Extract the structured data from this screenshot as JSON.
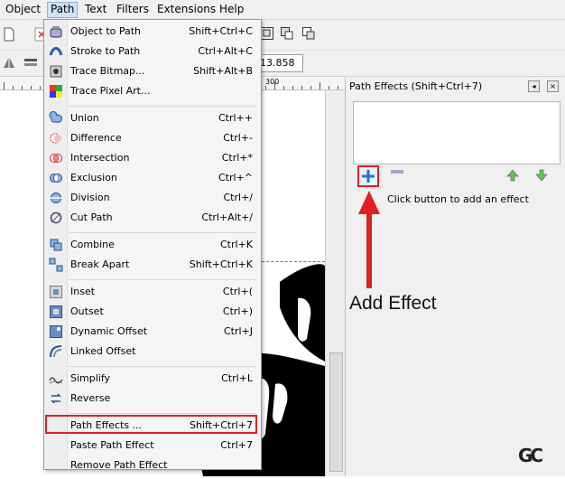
{
  "menubar": {
    "items": [
      "Object",
      "Path",
      "Text",
      "Filters",
      "Extensions",
      "Help"
    ],
    "active": "Path"
  },
  "toolbar": {
    "coord_value": "13.858"
  },
  "ruler": {
    "label": "300"
  },
  "path_menu": {
    "groups": [
      [
        {
          "label": "Object to Path",
          "shortcut": "Shift+Ctrl+C",
          "icon": "object-to-path-icon"
        },
        {
          "label": "Stroke to Path",
          "shortcut": "Ctrl+Alt+C",
          "icon": "stroke-to-path-icon"
        },
        {
          "label": "Trace Bitmap...",
          "shortcut": "Shift+Alt+B",
          "icon": "trace-bitmap-icon"
        },
        {
          "label": "Trace Pixel Art...",
          "shortcut": "",
          "icon": "trace-pixel-art-icon"
        }
      ],
      [
        {
          "label": "Union",
          "shortcut": "Ctrl++",
          "icon": "union-icon"
        },
        {
          "label": "Difference",
          "shortcut": "Ctrl+-",
          "icon": "difference-icon"
        },
        {
          "label": "Intersection",
          "shortcut": "Ctrl+*",
          "icon": "intersection-icon"
        },
        {
          "label": "Exclusion",
          "shortcut": "Ctrl+^",
          "icon": "exclusion-icon"
        },
        {
          "label": "Division",
          "shortcut": "Ctrl+/",
          "icon": "division-icon"
        },
        {
          "label": "Cut Path",
          "shortcut": "Ctrl+Alt+/",
          "icon": "cut-path-icon"
        }
      ],
      [
        {
          "label": "Combine",
          "shortcut": "Ctrl+K",
          "icon": "combine-icon"
        },
        {
          "label": "Break Apart",
          "shortcut": "Shift+Ctrl+K",
          "icon": "break-apart-icon"
        }
      ],
      [
        {
          "label": "Inset",
          "shortcut": "Ctrl+(",
          "icon": "inset-icon"
        },
        {
          "label": "Outset",
          "shortcut": "Ctrl+)",
          "icon": "outset-icon"
        },
        {
          "label": "Dynamic Offset",
          "shortcut": "Ctrl+J",
          "icon": "dynamic-offset-icon"
        },
        {
          "label": "Linked Offset",
          "shortcut": "",
          "icon": "linked-offset-icon"
        }
      ],
      [
        {
          "label": "Simplify",
          "shortcut": "Ctrl+L",
          "icon": "simplify-icon"
        },
        {
          "label": "Reverse",
          "shortcut": "",
          "icon": "reverse-icon"
        }
      ],
      [
        {
          "label": "Path Effects ...",
          "shortcut": "Shift+Ctrl+7",
          "icon": ""
        },
        {
          "label": "Paste Path Effect",
          "shortcut": "Ctrl+7",
          "icon": ""
        },
        {
          "label": "Remove Path Effect",
          "shortcut": "",
          "icon": ""
        }
      ]
    ]
  },
  "panel": {
    "title": "Path Effects  (Shift+Ctrl+7)",
    "hint": "Click button to add an effect",
    "annotation": "Add Effect"
  },
  "watermark": "GC",
  "colors": {
    "highlight": "#e02020",
    "menu_bg": "#f5f5f5",
    "panel_bg": "#f0f0f0",
    "arrow": "#e02020"
  }
}
